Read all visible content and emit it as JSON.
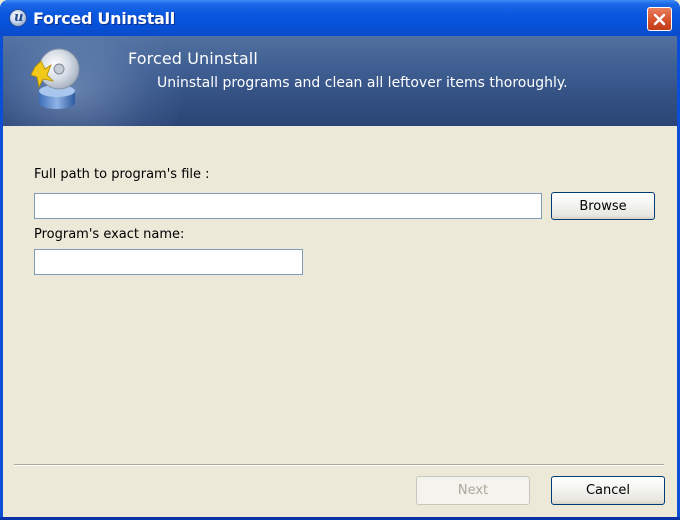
{
  "window": {
    "title": "Forced Uninstall",
    "app_icon": "uninstaller-app-icon",
    "close_icon": "close-icon"
  },
  "banner": {
    "title": "Forced Uninstall",
    "subtitle": "Uninstall programs and clean all leftover items thoroughly.",
    "icon": "disc-broom-icon"
  },
  "form": {
    "path_label": "Full path to program's file :",
    "path_value": "",
    "browse_label": "Browse",
    "name_label": "Program's exact name:",
    "name_value": ""
  },
  "footer": {
    "next_label": "Next",
    "next_enabled": false,
    "cancel_label": "Cancel"
  },
  "colors": {
    "titlebar": "#0a58e0",
    "banner": "#3f5f92",
    "dialog_bg": "#ece9d8",
    "close_button": "#d9542f"
  }
}
